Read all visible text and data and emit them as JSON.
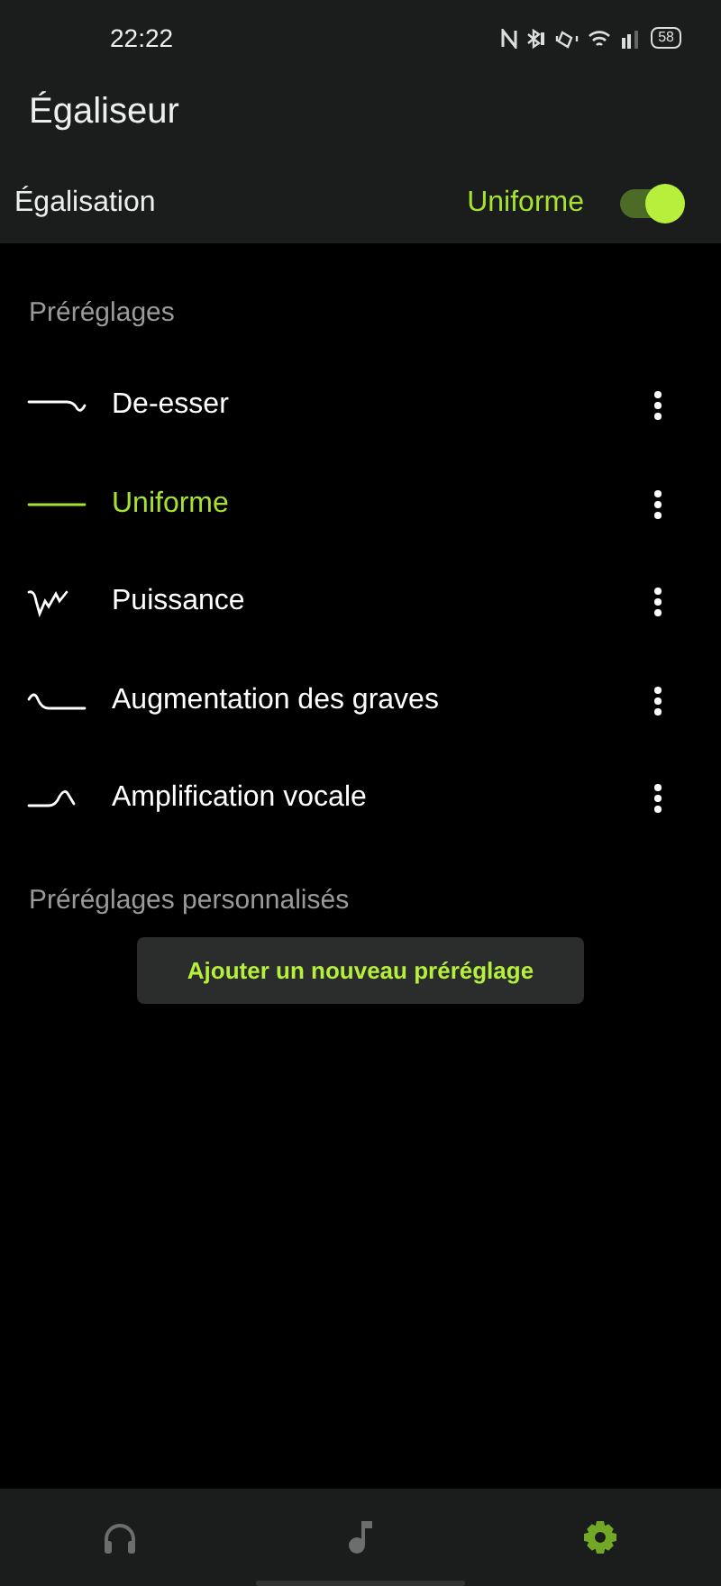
{
  "status_bar": {
    "time": "22:22",
    "battery": "58"
  },
  "title": "Égaliseur",
  "equalization": {
    "label": "Égalisation",
    "value": "Uniforme",
    "on": true
  },
  "presets_heading": "Préréglages",
  "presets": [
    {
      "name": "De-esser",
      "kind": "deesser",
      "selected": false
    },
    {
      "name": "Uniforme",
      "kind": "flat",
      "selected": true
    },
    {
      "name": "Puissance",
      "kind": "power",
      "selected": false
    },
    {
      "name": "Augmentation des graves",
      "kind": "bass",
      "selected": false
    },
    {
      "name": "Amplification vocale",
      "kind": "vocal",
      "selected": false
    }
  ],
  "custom_heading": "Préréglages personnalisés",
  "add_button": "Ajouter un nouveau préréglage",
  "nav": [
    {
      "kind": "headphones",
      "selected": false
    },
    {
      "kind": "music",
      "selected": false
    },
    {
      "kind": "settings",
      "selected": true
    }
  ]
}
